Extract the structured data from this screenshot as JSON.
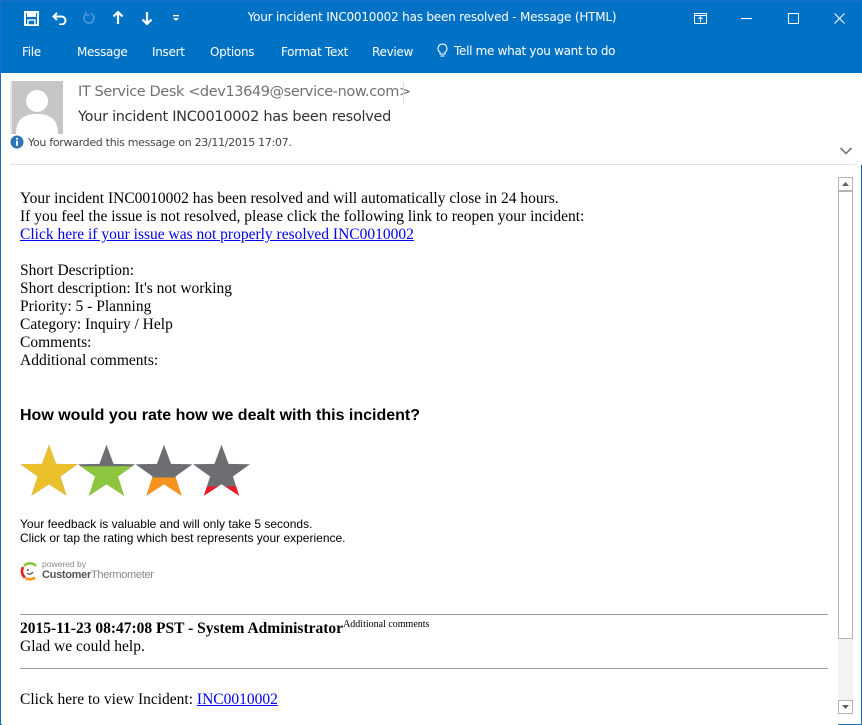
{
  "window": {
    "title": "Your incident INC0010002 has been resolved - Message (HTML)"
  },
  "quick_access": [
    {
      "name": "save-icon",
      "label": "Save"
    },
    {
      "name": "undo-icon",
      "label": "Undo"
    },
    {
      "name": "redo-icon",
      "label": "Redo",
      "disabled": true
    },
    {
      "name": "previous-item-icon",
      "label": "Previous Item"
    },
    {
      "name": "next-item-icon",
      "label": "Next Item"
    },
    {
      "name": "customize-qat-icon",
      "label": "Customize Quick Access Toolbar"
    }
  ],
  "window_controls": [
    "ribbon-display-options",
    "minimize",
    "maximize",
    "close"
  ],
  "ribbon": {
    "tabs": [
      "File",
      "Message",
      "Insert",
      "Options",
      "Format Text",
      "Review"
    ],
    "tell_me": "Tell me what you want to do"
  },
  "header": {
    "sender": "IT Service Desk <dev13649@service-now.com>",
    "subject": "Your incident INC0010002 has been resolved",
    "info": "You forwarded this message on 23/11/2015 17:07."
  },
  "body": {
    "intro_line1": "Your incident INC0010002 has been resolved and will automatically close in 24 hours.",
    "intro_line2": "If you feel the issue is not resolved, please click the following link to reopen your incident:",
    "reopen_link": "Click here if your issue was not properly resolved INC0010002",
    "details": [
      "Short Description:",
      "Short description: It's not working",
      "Priority: 5 - Planning",
      "Category: Inquiry / Help",
      "Comments:",
      "Additional comments:"
    ],
    "rating_question": "How would you rate how we dealt with this incident?",
    "rating_stars": [
      {
        "name": "star-gold",
        "color": "#eac12d",
        "fill_fraction": 1.0
      },
      {
        "name": "star-green",
        "color": "#8cc63f",
        "fill_fraction": 0.62
      },
      {
        "name": "star-orange",
        "color": "#f7941d",
        "fill_fraction": 0.42
      },
      {
        "name": "star-red",
        "color": "#ed1c24",
        "fill_fraction": 0.26
      }
    ],
    "star_base_color": "#6d6e71",
    "feedback_line1": "Your feedback is valuable and will only take 5 seconds.",
    "feedback_line2": "Click or tap the rating which best represents your experience.",
    "powered_by": "powered by",
    "brand_bold": "Customer",
    "brand_light": "Thermometer",
    "comment_meta": "2015-11-23 08:47:08 PST - System Administrator",
    "comment_type": "Additional comments",
    "comment_text": "Glad we could help.",
    "view_incident_label": "Click here to view Incident: ",
    "view_incident_link": "INC0010002"
  },
  "colors": {
    "titlebar": "#0072c6",
    "link": "#0000ee",
    "info_icon": "#2e75b6"
  },
  "scroll": {
    "position_fraction": 0.0,
    "visible_fraction": 0.88
  }
}
